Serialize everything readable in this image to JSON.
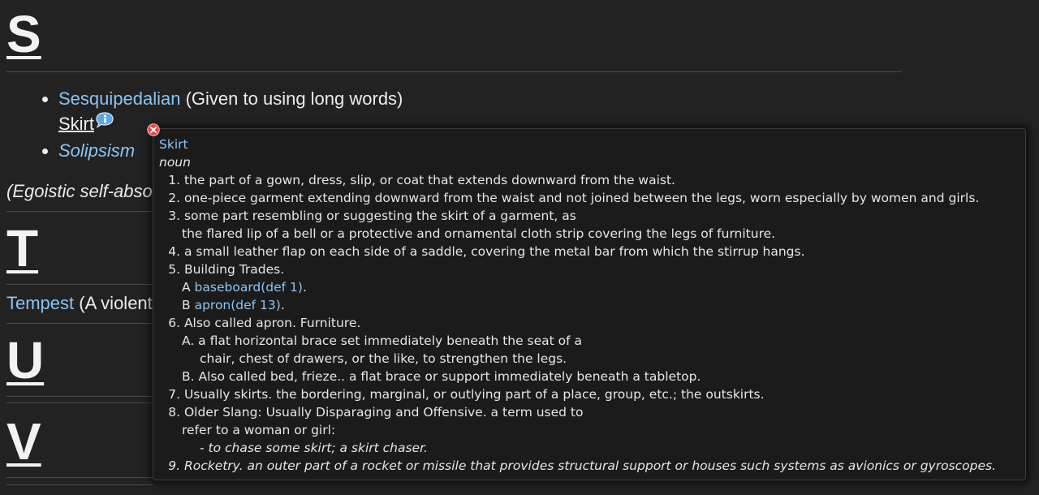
{
  "sections": {
    "s": {
      "letter": "S"
    },
    "t": {
      "letter": "T"
    },
    "u": {
      "letter": "U"
    },
    "v": {
      "letter": "V"
    }
  },
  "s_list": {
    "item1_term": "Sesquipedalian",
    "item1_gloss": "(Given to using long words)",
    "hover_word": "Skirt",
    "item2_term": "Solipsism"
  },
  "partial_texts": {
    "egoistic": "(Egoistic self-abso",
    "tempest_term": "Tempest",
    "tempest_gloss": "(A violent"
  },
  "popup": {
    "word": "Skirt",
    "part_of_speech": "noun",
    "defs": {
      "d1": "the part of a gown, dress, slip, or coat that extends downward from the waist.",
      "d2": "one-piece garment extending downward from the waist and not joined between the legs, worn especially by women and girls.",
      "d3": "some part resembling or suggesting the skirt of a garment, as",
      "d3_sub": "the flared lip of a bell or a protective and ornamental cloth strip covering the legs of furniture.",
      "d4": "a small leather flap on each side of a saddle, covering the metal bar from which the stirrup hangs.",
      "d5": "Building Trades.",
      "d5_a_prefix": "A",
      "d5_a_link": "baseboard(def 1)",
      "d5_b_prefix": "B",
      "d5_b_link": "apron(def 13)",
      "d6": "Also called apron. Furniture.",
      "d6_a1": "A. a flat horizontal brace set immediately beneath the seat of a",
      "d6_a2": "chair, chest of drawers, or the like, to strengthen the legs.",
      "d6_b": "B. Also called bed, frieze.. a flat brace or support immediately beneath a tabletop.",
      "d7": "Usually skirts. the bordering, marginal, or outlying part of a place, group, etc.; the outskirts.",
      "d8": "Older Slang: Usually Disparaging and Offensive. a term used to",
      "d8_sub": "refer to a woman or girl:",
      "d8_example": "- to chase some skirt; a skirt chaser.",
      "d9": "Rocketry. an outer part of a rocket or missile that provides structural support or houses such systems as avionics or gyroscopes."
    },
    "nums": [
      "1.",
      "2.",
      "3.",
      "4.",
      "5.",
      "6.",
      "7.",
      "8.",
      "9."
    ]
  },
  "icons": {
    "info": "info-bubble-icon",
    "close": "close-icon"
  },
  "colors": {
    "background": "#222222",
    "link": "#8cc4f2",
    "popup_bg": "#1b1b1b",
    "close_red": "#e0484a"
  }
}
